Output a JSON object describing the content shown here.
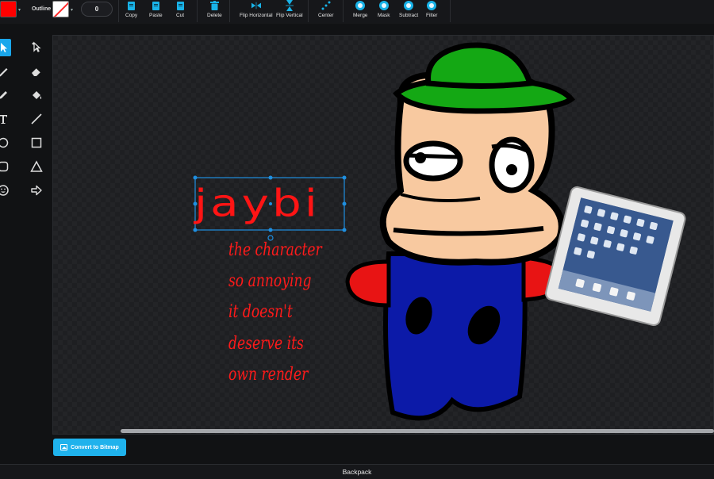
{
  "toolbar": {
    "fill_color": "#ff0000",
    "outline_label": "Outline",
    "outline_color": "none",
    "stroke_width": "0",
    "buttons": [
      {
        "label": "Copy",
        "icon": "copy-icon"
      },
      {
        "label": "Paste",
        "icon": "paste-icon"
      },
      {
        "label": "Cut",
        "icon": "cut-icon"
      },
      {
        "label": "Delete",
        "icon": "trash-icon"
      },
      {
        "label": "Flip Horizontal",
        "icon": "flip-horizontal-icon"
      },
      {
        "label": "Flip Vertical",
        "icon": "flip-vertical-icon"
      },
      {
        "label": "Center",
        "icon": "center-icon"
      },
      {
        "label": "Merge",
        "icon": "merge-icon"
      },
      {
        "label": "Mask",
        "icon": "mask-icon"
      },
      {
        "label": "Subtract",
        "icon": "subtract-icon"
      },
      {
        "label": "Filter",
        "icon": "filter-icon"
      }
    ]
  },
  "tools": [
    {
      "name": "select-tool",
      "icon": "arrow-cursor-icon",
      "active": true
    },
    {
      "name": "reshape-tool",
      "icon": "reshape-icon"
    },
    {
      "name": "brush-tool",
      "icon": "brush-icon"
    },
    {
      "name": "eraser-tool",
      "icon": "eraser-icon"
    },
    {
      "name": "pen-tool",
      "icon": "pen-icon"
    },
    {
      "name": "fill-tool",
      "icon": "paint-bucket-icon"
    },
    {
      "name": "text-tool",
      "icon": "text-icon"
    },
    {
      "name": "line-tool",
      "icon": "line-icon"
    },
    {
      "name": "circle-tool",
      "icon": "circle-icon"
    },
    {
      "name": "rectangle-tool",
      "icon": "rectangle-icon"
    },
    {
      "name": "rounded-rect-tool",
      "icon": "rounded-rect-icon"
    },
    {
      "name": "triangle-tool",
      "icon": "triangle-icon"
    },
    {
      "name": "emoji-tool",
      "icon": "smiley-icon"
    },
    {
      "name": "arrow-tool",
      "icon": "arrow-icon"
    }
  ],
  "canvas": {
    "title_text": "jaybi",
    "note_lines": [
      "the character",
      "so annoying",
      "it doesn't",
      "deserve its",
      "own render"
    ],
    "colors": {
      "text": "#ff1414",
      "hat": "#14a814",
      "skin": "#f8c9a0",
      "body": "#0c1aa8",
      "arm": "#e81414",
      "tablet_frame": "#e8e8e8"
    }
  },
  "convert_button": "Convert to Bitmap",
  "backpack_label": "Backpack"
}
